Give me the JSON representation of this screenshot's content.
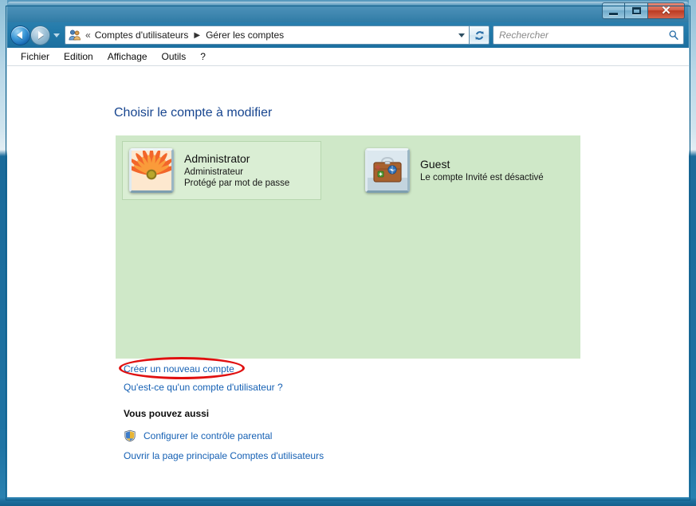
{
  "window": {
    "title": "Gérer les comptes",
    "controls": {
      "minimize_label": "Réduire",
      "maximize_label": "Agrandir",
      "close_label": "✕"
    }
  },
  "navigation": {
    "back_label": "Précédent",
    "forward_label": "Suivant",
    "history_label": "Pages récentes",
    "refresh_label": "Actualiser"
  },
  "address_bar": {
    "icon": "users-icon",
    "overflow_chevrons": "«",
    "separator": "▶",
    "crumbs": [
      {
        "label": "Comptes d'utilisateurs"
      },
      {
        "label": "Gérer les comptes"
      }
    ],
    "dropdown_label": "Historique des adresses"
  },
  "search": {
    "placeholder": "Rechercher",
    "value": "",
    "icon": "search-icon"
  },
  "menu": {
    "items": [
      {
        "label": "Fichier"
      },
      {
        "label": "Edition"
      },
      {
        "label": "Affichage"
      },
      {
        "label": "Outils"
      },
      {
        "label": "?"
      }
    ]
  },
  "main": {
    "page_title": "Choisir le compte à modifier",
    "accounts": [
      {
        "name": "Administrator",
        "line2": "Administrateur",
        "line3": "Protégé par mot de passe",
        "avatar": "flower-avatar-icon",
        "selected": true
      },
      {
        "name": "Guest",
        "line2": "Le compte Invité est désactivé",
        "line3": "",
        "avatar": "suitcase-avatar-icon",
        "selected": false
      }
    ],
    "create_account_link": "Créer un nouveau compte",
    "what_is_account_link": "Qu'est-ce qu'un compte d'utilisateur ?",
    "also_heading": "Vous pouvez aussi",
    "parental_control_link": "Configurer le contrôle parental",
    "parental_control_icon": "uac-shield-icon",
    "home_link": "Ouvrir la page principale Comptes d'utilisateurs"
  },
  "annotation": {
    "highlight_target": "Créer un nouveau compte",
    "highlight_color": "#e01010",
    "shape": "ellipse"
  },
  "colors": {
    "frame_blue": "#1c6f9f",
    "panel_green": "#cfe8c8",
    "tile_selected_green": "#daeed4",
    "link_blue": "#1560b4",
    "title_blue": "#17458f",
    "close_red": "#bb3a22"
  }
}
